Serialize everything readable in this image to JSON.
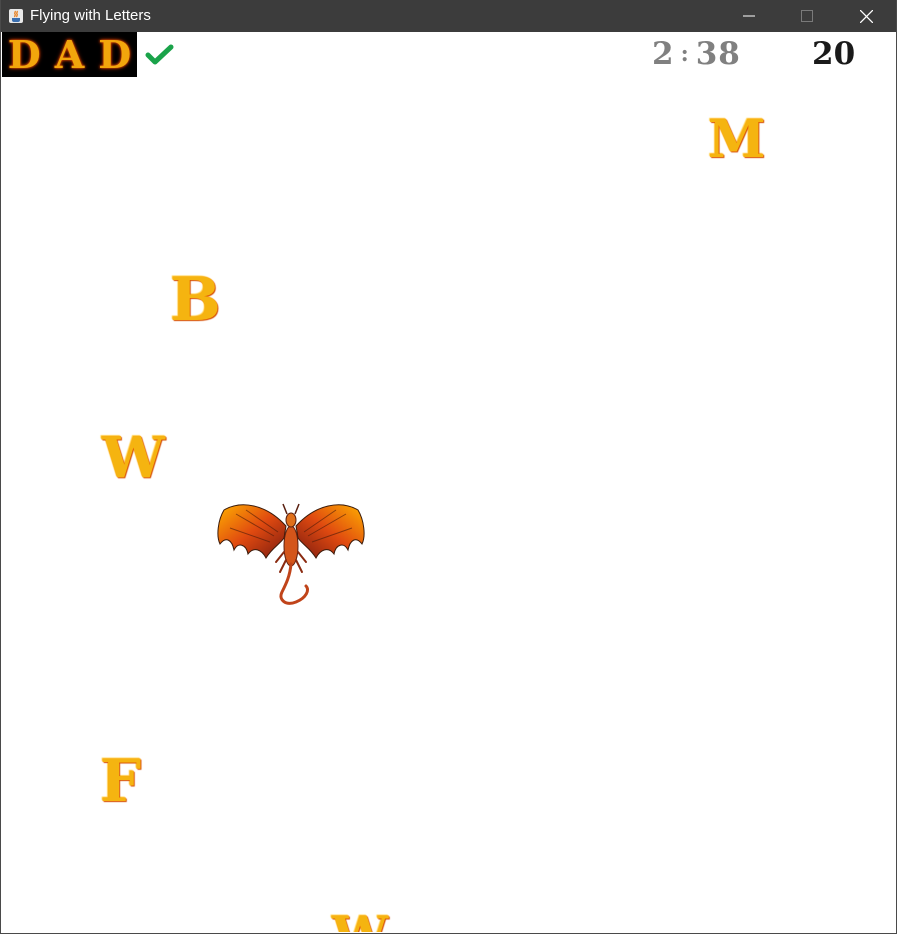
{
  "window": {
    "title": "Flying with Letters",
    "minimize_icon": "minimize-icon",
    "maximize_icon": "maximize-icon",
    "close_icon": "close-icon"
  },
  "hud": {
    "target_word": [
      "D",
      "A",
      "D"
    ],
    "target_word_status_icon": "checkmark-icon",
    "timer": {
      "minutes": "2",
      "separator": ":",
      "seconds": "38"
    },
    "score": "20"
  },
  "game": {
    "flying_letters": [
      "M",
      "B",
      "W",
      "F",
      "W"
    ],
    "player_sprite": "dragon"
  },
  "colors": {
    "titlebar": "#3c3c3c",
    "fire_letter": "#f5b410",
    "fire_glow": "#ff7a00",
    "check": "#1aa34a",
    "timer": "#808080",
    "score": "#1a1a1a"
  }
}
